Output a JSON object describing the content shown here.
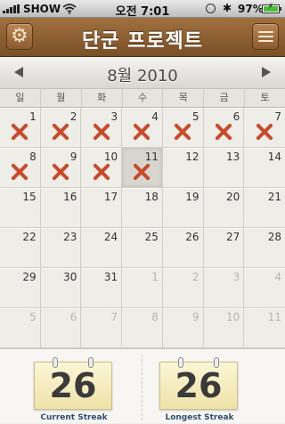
{
  "status_bar": {
    "carrier": "SHOW",
    "time": "오전 7:01",
    "battery_percent": "97%",
    "battery_level": 0.97
  },
  "nav": {
    "title": "단군 프로젝트",
    "left_icon": "gear-icon",
    "right_icon": "list-icon"
  },
  "calendar": {
    "month_title": "8월 2010",
    "weekdays": [
      "일",
      "월",
      "화",
      "수",
      "목",
      "금",
      "토"
    ],
    "days": [
      {
        "n": "1",
        "x": true
      },
      {
        "n": "2",
        "x": true
      },
      {
        "n": "3",
        "x": true
      },
      {
        "n": "4",
        "x": true
      },
      {
        "n": "5",
        "x": true
      },
      {
        "n": "6",
        "x": true
      },
      {
        "n": "7",
        "x": true
      },
      {
        "n": "8",
        "x": true
      },
      {
        "n": "9",
        "x": true
      },
      {
        "n": "10",
        "x": true
      },
      {
        "n": "11",
        "x": true,
        "today": true
      },
      {
        "n": "12"
      },
      {
        "n": "13"
      },
      {
        "n": "14"
      },
      {
        "n": "15"
      },
      {
        "n": "16"
      },
      {
        "n": "17"
      },
      {
        "n": "18"
      },
      {
        "n": "19"
      },
      {
        "n": "20"
      },
      {
        "n": "21"
      },
      {
        "n": "22"
      },
      {
        "n": "23"
      },
      {
        "n": "24"
      },
      {
        "n": "25"
      },
      {
        "n": "26"
      },
      {
        "n": "27"
      },
      {
        "n": "28"
      },
      {
        "n": "29"
      },
      {
        "n": "30"
      },
      {
        "n": "31"
      },
      {
        "n": "1",
        "other": true
      },
      {
        "n": "2",
        "other": true
      },
      {
        "n": "3",
        "other": true
      },
      {
        "n": "4",
        "other": true
      },
      {
        "n": "5",
        "other": true
      },
      {
        "n": "6",
        "other": true
      },
      {
        "n": "7",
        "other": true
      },
      {
        "n": "8",
        "other": true
      },
      {
        "n": "9",
        "other": true
      },
      {
        "n": "10",
        "other": true
      },
      {
        "n": "11",
        "other": true
      }
    ]
  },
  "streaks": {
    "current": {
      "value": "26",
      "label": "Current Streak"
    },
    "longest": {
      "value": "26",
      "label": "Longest Streak"
    }
  },
  "colors": {
    "nav_brown": "#8b5a2f",
    "x_mark_red": "#c94a2a",
    "streak_label_blue": "#2e4d6e",
    "note_card_yellow": "#f4ebbd"
  }
}
